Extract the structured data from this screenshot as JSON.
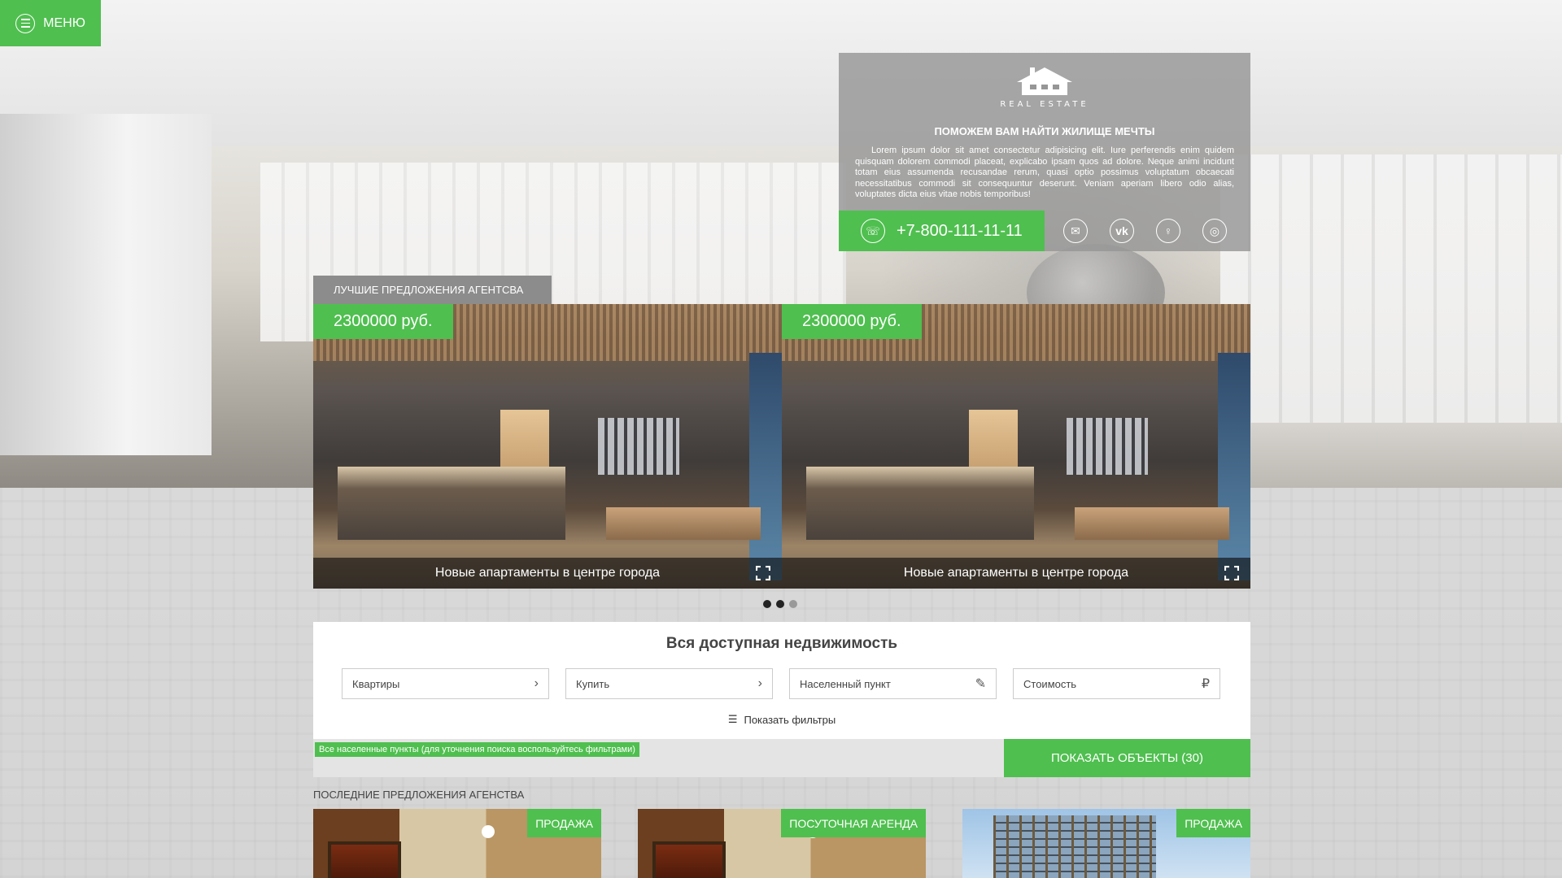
{
  "menu": {
    "label": "МЕНЮ"
  },
  "info": {
    "logo_text": "REAL ESTATE",
    "title": "ПОМОЖЕМ ВАМ НАЙТИ ЖИЛИЩЕ МЕЧТЫ",
    "text": "Lorem ipsum dolor sit amet consectetur adipisicing elit. Iure perferendis enim quidem quisquam dolorem commodi placeat, explicabo ipsam quos ad dolore. Neque animi incidunt totam eius assumenda recusandae rerum, quasi optio possimus voluptatum obcaecati necessitatibus commodi sit consequuntur deserunt. Veniam aperiam libero odio alias, voluptates dicta eius vitae nobis temporibus!",
    "phone": "+7-800-111-11-11",
    "socials": [
      "mail-icon",
      "vk-icon",
      "odnoklassniki-icon",
      "instagram-icon"
    ]
  },
  "best": {
    "label": "ЛУЧШИЕ ПРЕДЛОЖЕНИЯ АГЕНТСВА",
    "slides": [
      {
        "price": "2300000 руб.",
        "caption": "Новые апартаменты в центре города"
      },
      {
        "price": "2300000 руб.",
        "caption": "Новые апартаменты в центре города"
      }
    ],
    "dots": 3,
    "active_dot": 1
  },
  "search": {
    "title": "Вся доступная недвижимость",
    "filters": [
      {
        "label": "Квартиры",
        "icon": "chevron-right-icon"
      },
      {
        "label": "Купить",
        "icon": "chevron-right-icon"
      },
      {
        "label": "Населенный пункт",
        "icon": "edit-icon"
      },
      {
        "label": "Стоимость",
        "icon": "ruble-icon"
      }
    ],
    "show_filters": "Показать фильтры",
    "hint": "Все населенные пункты (для уточнения поиска воспользуйтесь фильтрами)",
    "show_button": "ПОКАЗАТЬ ОБЪЕКТЫ (30)"
  },
  "latest": {
    "label": "ПОСЛЕДНИЕ ПРЕДЛОЖЕНИЯ АГЕНСТВА",
    "cards": [
      {
        "badge": "ПРОДАЖА"
      },
      {
        "badge": "ПОСУТОЧНАЯ АРЕНДА"
      },
      {
        "badge": "ПРОДАЖА"
      }
    ]
  },
  "colors": {
    "accent": "#4fbf4f",
    "panel": "#969696"
  }
}
